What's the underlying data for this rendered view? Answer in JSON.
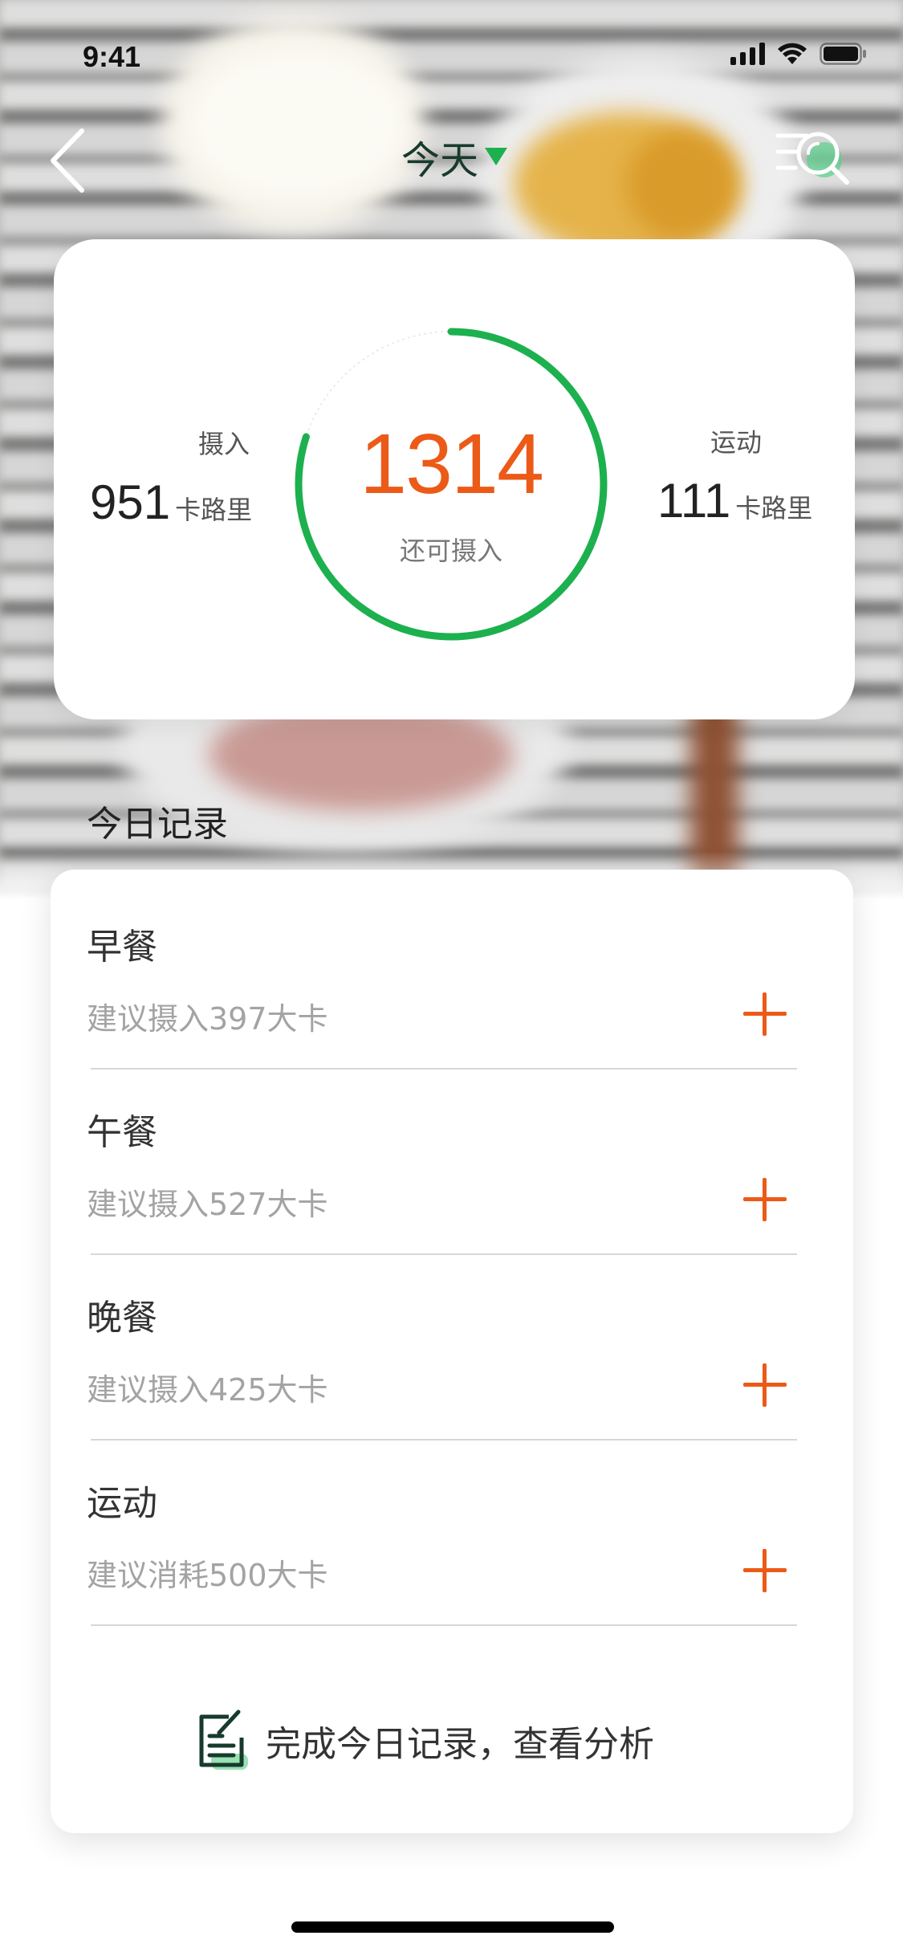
{
  "status_bar": {
    "time": "9:41",
    "icons": [
      "signal-icon",
      "wifi-icon",
      "battery-icon"
    ]
  },
  "nav": {
    "back_icon": "chevron-left-icon",
    "title": "今天",
    "dropdown_icon": "caret-down-icon",
    "search_icon": "search-list-icon"
  },
  "summary": {
    "intake_label": "摄入",
    "intake_value": "951",
    "intake_unit": "卡路里",
    "remaining_value": "1314",
    "remaining_label": "还可摄入",
    "remaining_progress_fraction": 0.8,
    "exercise_label": "运动",
    "exercise_value": "111",
    "exercise_unit": "卡路里"
  },
  "section_title": "今日记录",
  "records": [
    {
      "name": "早餐",
      "suggestion": "建议摄入397大卡"
    },
    {
      "name": "午餐",
      "suggestion": "建议摄入527大卡"
    },
    {
      "name": "晚餐",
      "suggestion": "建议摄入425大卡"
    },
    {
      "name": "运动",
      "suggestion": "建议消耗500大卡"
    }
  ],
  "complete_action": {
    "label": "完成今日记录，查看分析",
    "icon": "notepad-icon"
  },
  "colors": {
    "accent_orange": "#ec5a18",
    "ring_green": "#1db04e",
    "title_dark_green": "#173a2c"
  }
}
